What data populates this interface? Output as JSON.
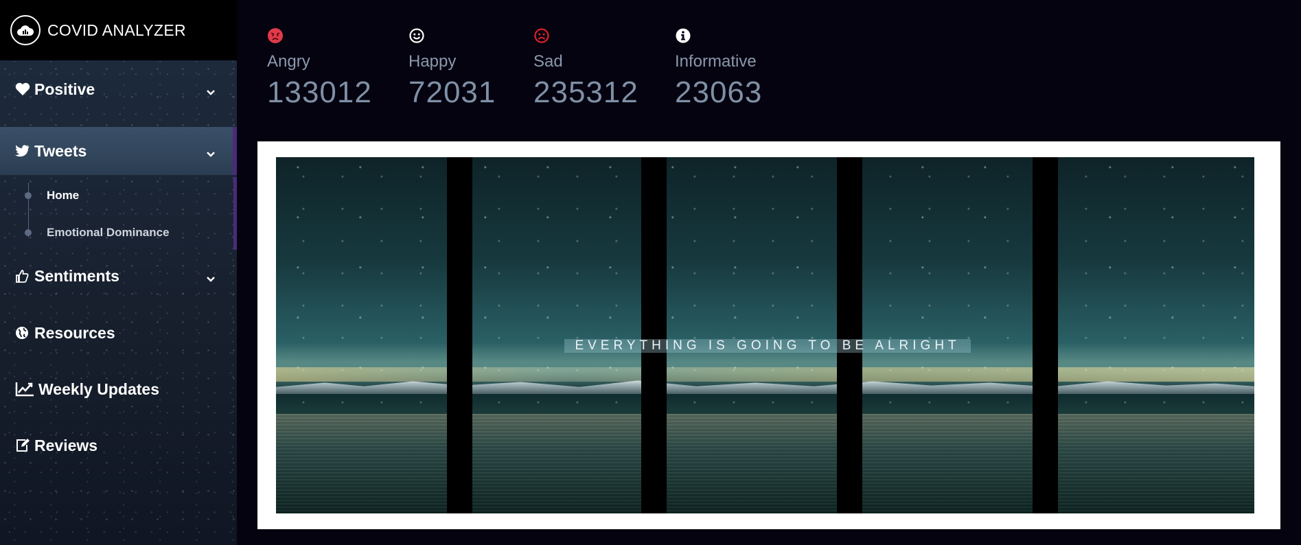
{
  "brand": {
    "title": "COVID ANALYZER",
    "logo_icon": "cloud-chart-icon"
  },
  "sidebar": {
    "items": [
      {
        "label": "Positive",
        "icon": "heart-icon",
        "has_chevron": true
      },
      {
        "label": "Tweets",
        "icon": "twitter-icon",
        "has_chevron": true,
        "active": true,
        "subitems": [
          {
            "label": "Home",
            "active": true
          },
          {
            "label": "Emotional Dominance"
          }
        ]
      },
      {
        "label": "Sentiments",
        "icon": "thumbs-up-icon",
        "has_chevron": true
      },
      {
        "label": "Resources",
        "icon": "globe-icon"
      },
      {
        "label": "Weekly Updates",
        "icon": "line-chart-icon"
      },
      {
        "label": "Reviews",
        "icon": "edit-icon"
      }
    ]
  },
  "stats": [
    {
      "label": "Angry",
      "value": "133012",
      "icon": "angry-face-icon",
      "color": "#e23a4a"
    },
    {
      "label": "Happy",
      "value": "72031",
      "icon": "smile-face-icon",
      "color": "#ffffff"
    },
    {
      "label": "Sad",
      "value": "235312",
      "icon": "sad-face-icon",
      "color": "#e0202a"
    },
    {
      "label": "Informative",
      "value": "23063",
      "icon": "info-icon",
      "color": "#ffffff"
    }
  ],
  "hero": {
    "caption": "EVERYTHING IS GOING TO BE ALRIGHT"
  },
  "colors": {
    "background": "#05030f",
    "accent": "#4b2a7a",
    "stat_text": "#8a99ad"
  }
}
